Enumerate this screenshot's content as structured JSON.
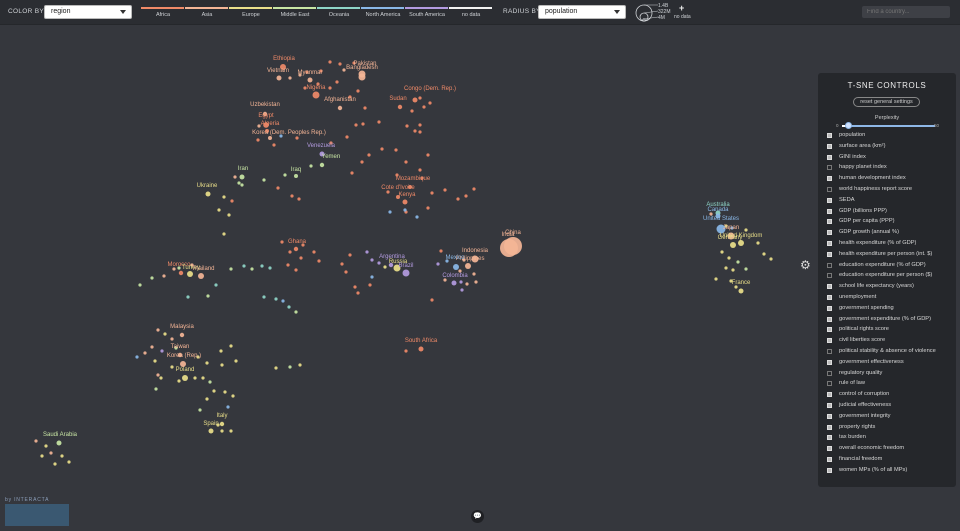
{
  "topbar": {
    "color_by_label": "COLOR BY",
    "color_by_value": "region",
    "radius_by_label": "RADIUS BY",
    "radius_by_value": "population",
    "legend": [
      {
        "name": "Africa",
        "color": "#f08a68"
      },
      {
        "name": "Asia",
        "color": "#f4b596"
      },
      {
        "name": "Europe",
        "color": "#eadf8a"
      },
      {
        "name": "Middle East",
        "color": "#c8e6a4"
      },
      {
        "name": "Oceania",
        "color": "#8fd6c8"
      },
      {
        "name": "North America",
        "color": "#8ab8e8"
      },
      {
        "name": "South America",
        "color": "#b39be0"
      },
      {
        "name": "no data",
        "color": "#f2f2f2"
      }
    ],
    "size_legend": [
      "1.4B",
      "322M",
      "4M"
    ],
    "nodata_label": "no data",
    "search_placeholder": "Find a country..."
  },
  "panel": {
    "title": "T-SNE CONTROLS",
    "reset_label": "reset general settings",
    "perplexity_label": "Perplexity",
    "perplexity_min": "0",
    "perplexity_max": "50",
    "perplexity_value": 3,
    "features": [
      {
        "label": "population",
        "checked": true
      },
      {
        "label": "surface area (km²)",
        "checked": true
      },
      {
        "label": "GINI index",
        "checked": true
      },
      {
        "label": "happy planet index",
        "checked": false
      },
      {
        "label": "human development index",
        "checked": true
      },
      {
        "label": "world happiness report score",
        "checked": false
      },
      {
        "label": "SEDA",
        "checked": true
      },
      {
        "label": "GDP (billions PPP)",
        "checked": true
      },
      {
        "label": "GDP per capita (PPP)",
        "checked": true
      },
      {
        "label": "GDP growth (annual %)",
        "checked": true
      },
      {
        "label": "health expenditure (% of GDP)",
        "checked": true
      },
      {
        "label": "health expenditure per person (int. $)",
        "checked": true
      },
      {
        "label": "education expenditure (% of GDP)",
        "checked": false
      },
      {
        "label": "education expenditure per person ($)",
        "checked": false
      },
      {
        "label": "school life expectancy (years)",
        "checked": true
      },
      {
        "label": "unemployment",
        "checked": true
      },
      {
        "label": "government spending",
        "checked": true
      },
      {
        "label": "government expenditure (% of GDP)",
        "checked": true
      },
      {
        "label": "political rights score",
        "checked": true
      },
      {
        "label": "civil liberties score",
        "checked": true
      },
      {
        "label": "political stability & absence of violence",
        "checked": false
      },
      {
        "label": "government effectiveness",
        "checked": true
      },
      {
        "label": "regulatory quality",
        "checked": false
      },
      {
        "label": "rule of law",
        "checked": false
      },
      {
        "label": "control of corruption",
        "checked": true
      },
      {
        "label": "judicial effectiveness",
        "checked": true
      },
      {
        "label": "government integrity",
        "checked": true
      },
      {
        "label": "property rights",
        "checked": true
      },
      {
        "label": "tax burden",
        "checked": true
      },
      {
        "label": "overall economic freedom",
        "checked": true
      },
      {
        "label": "financial freedom",
        "checked": true
      },
      {
        "label": "women MPs (% of all MPs)",
        "checked": true
      }
    ]
  },
  "countries": [
    {
      "name": "Ethiopia",
      "region": "Africa"
    },
    {
      "name": "Vietnam",
      "region": "Asia"
    },
    {
      "name": "Congo (Dem. Rep.)",
      "region": "Africa"
    },
    {
      "name": "Pakistan",
      "region": "Asia"
    },
    {
      "name": "Bangladesh",
      "region": "Asia"
    },
    {
      "name": "Myanmar",
      "region": "Asia"
    },
    {
      "name": "Nigeria",
      "region": "Africa"
    },
    {
      "name": "Afghanistan",
      "region": "Asia"
    },
    {
      "name": "Sudan",
      "region": "Africa"
    },
    {
      "name": "Uzbekistan",
      "region": "Asia"
    },
    {
      "name": "Egypt",
      "region": "Africa"
    },
    {
      "name": "Algeria",
      "region": "Africa"
    },
    {
      "name": "Korea (Dem. Peoples Rep.)",
      "region": "Asia"
    },
    {
      "name": "Venezuela",
      "region": "South America"
    },
    {
      "name": "Yemen",
      "region": "Middle East"
    },
    {
      "name": "Mozambique",
      "region": "Africa"
    },
    {
      "name": "Iran",
      "region": "Middle East"
    },
    {
      "name": "Iraq",
      "region": "Middle East"
    },
    {
      "name": "Cote d'Ivoire",
      "region": "Africa"
    },
    {
      "name": "Kenya",
      "region": "Africa"
    },
    {
      "name": "Ukraine",
      "region": "Europe"
    },
    {
      "name": "China",
      "region": "Asia"
    },
    {
      "name": "India",
      "region": "Asia"
    },
    {
      "name": "Indonesia",
      "region": "Asia"
    },
    {
      "name": "Philippines",
      "region": "Asia"
    },
    {
      "name": "Mexico",
      "region": "North America"
    },
    {
      "name": "Colombia",
      "region": "South America"
    },
    {
      "name": "Ghana",
      "region": "Africa"
    },
    {
      "name": "Argentina",
      "region": "South America"
    },
    {
      "name": "Russia",
      "region": "Europe"
    },
    {
      "name": "Brazil",
      "region": "South America"
    },
    {
      "name": "Morocco",
      "region": "Africa"
    },
    {
      "name": "Turkey",
      "region": "Europe"
    },
    {
      "name": "Thailand",
      "region": "Asia"
    },
    {
      "name": "Australia",
      "region": "Oceania"
    },
    {
      "name": "Canada",
      "region": "North America"
    },
    {
      "name": "United States",
      "region": "North America"
    },
    {
      "name": "Japan",
      "region": "Asia"
    },
    {
      "name": "United Kingdom",
      "region": "Europe"
    },
    {
      "name": "Germany",
      "region": "Europe"
    },
    {
      "name": "France",
      "region": "Europe"
    },
    {
      "name": "Malaysia",
      "region": "Asia"
    },
    {
      "name": "Taiwan",
      "region": "Asia"
    },
    {
      "name": "Korea (Rep.)",
      "region": "Asia"
    },
    {
      "name": "Poland",
      "region": "Europe"
    },
    {
      "name": "South Africa",
      "region": "Africa"
    },
    {
      "name": "Italy",
      "region": "Europe"
    },
    {
      "name": "Spain",
      "region": "Europe"
    },
    {
      "name": "Saudi Arabia",
      "region": "Middle East"
    }
  ],
  "branding": {
    "by_label": "by INTERACTA"
  }
}
